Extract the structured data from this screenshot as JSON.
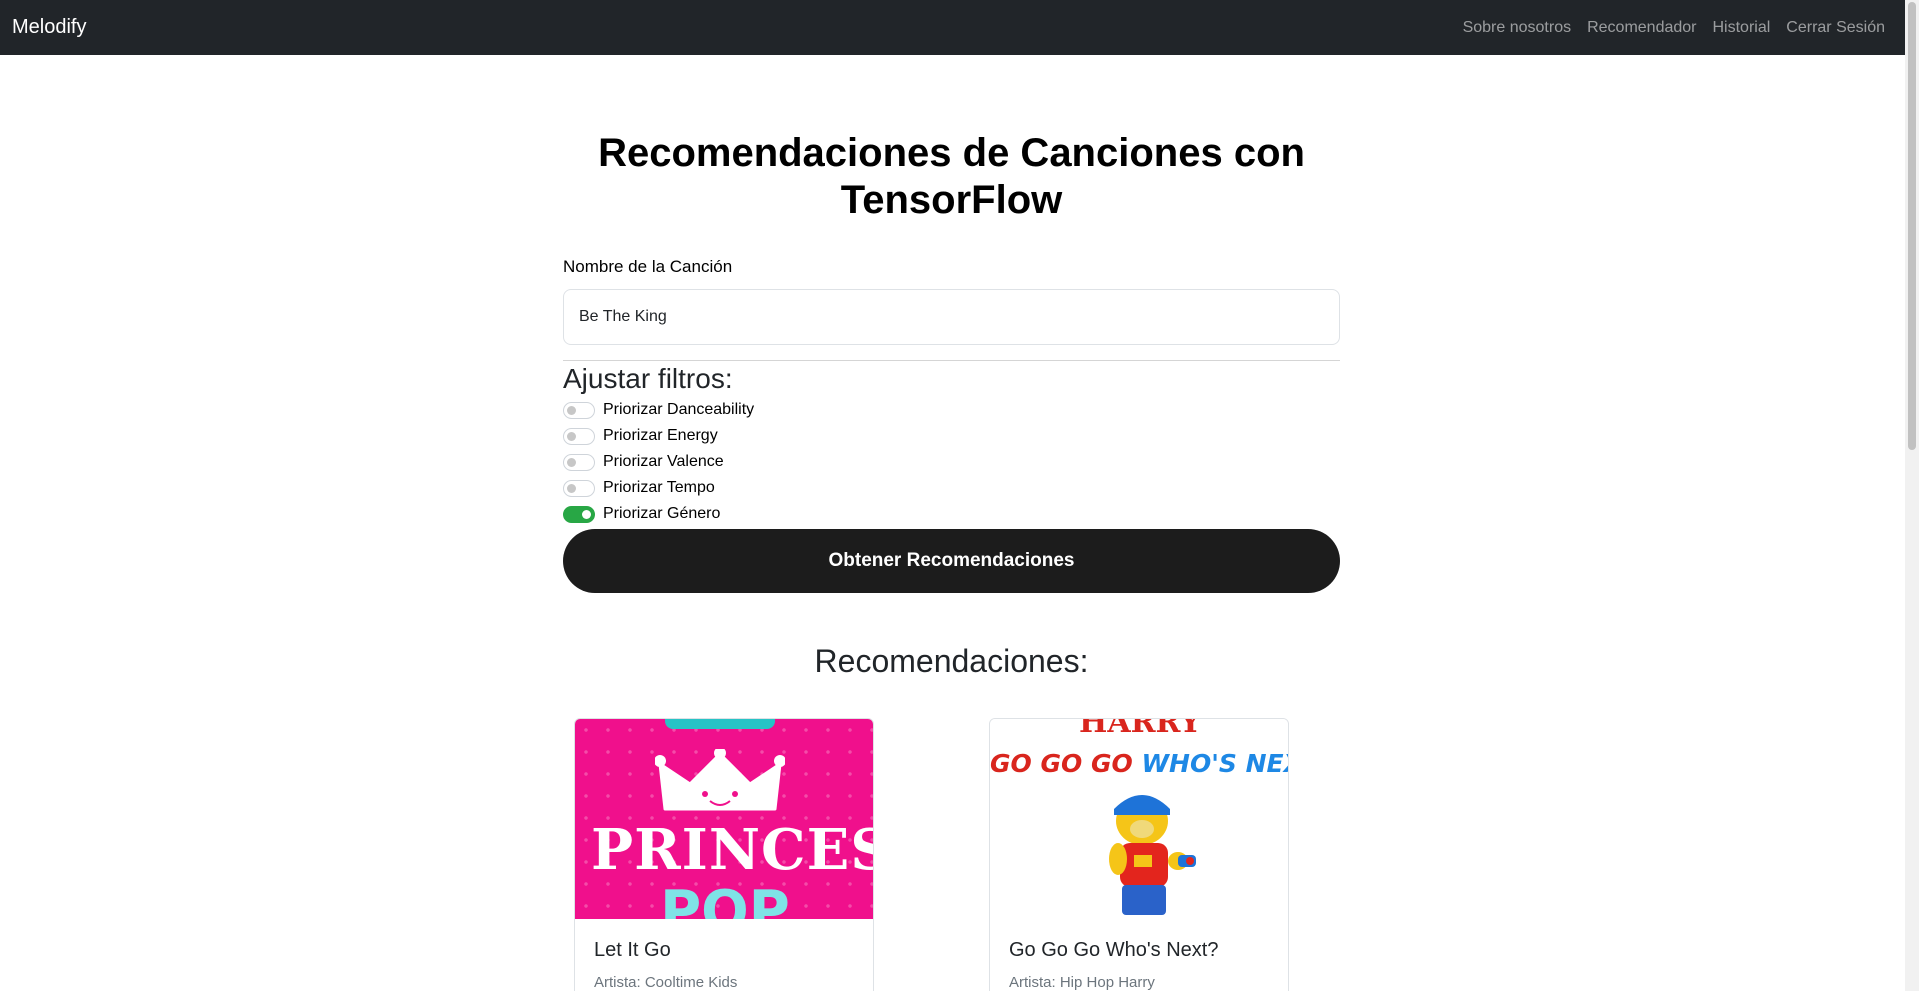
{
  "navbar": {
    "brand": "Melodify",
    "links": [
      "Sobre nosotros",
      "Recomendador",
      "Historial",
      "Cerrar Sesión"
    ]
  },
  "main": {
    "title": "Recomendaciones de Canciones con TensorFlow",
    "song_label": "Nombre de la Canción",
    "song_value": "Be The King",
    "filters_title": "Ajustar filtros:",
    "filters": [
      {
        "label": "Priorizar Danceability",
        "on": false
      },
      {
        "label": "Priorizar Energy",
        "on": false
      },
      {
        "label": "Priorizar Valence",
        "on": false
      },
      {
        "label": "Priorizar Tempo",
        "on": false
      },
      {
        "label": "Priorizar Género",
        "on": true
      }
    ],
    "submit_label": "Obtener Recomendaciones",
    "recs_title": "Recomendaciones:"
  },
  "recommendations": [
    {
      "title": "Let It Go",
      "artist": "Artista: Cooltime Kids",
      "art_text": "PRINCESS",
      "art_text_2": "POP"
    },
    {
      "title": "Go Go Go Who's Next?",
      "artist": "Artista: Hip Hop Harry",
      "art_text": "HARRY",
      "art_text_2a": "GO GO GO",
      "art_text_2b": "WHO'S NEXT?"
    }
  ],
  "colors": {
    "navbar_bg": "#212529",
    "button_bg": "#1c1c1c",
    "switch_on": "#28a745",
    "art1_bg": "#f0108c"
  }
}
